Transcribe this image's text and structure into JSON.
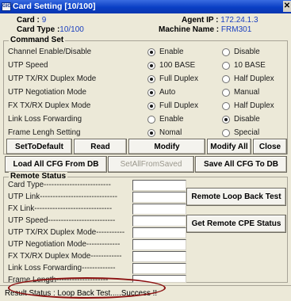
{
  "window": {
    "title": "Card Setting [10/100]",
    "icon_text": "GIGA"
  },
  "info": {
    "card_label": "Card :",
    "card_value": "9",
    "card_type_label": "Card Type :",
    "card_type_value": "10/100",
    "agent_ip_label": "Agent IP :",
    "agent_ip_value": "172.24.1.3",
    "machine_name_label": "Machine Name :",
    "machine_name_value": "FRM301"
  },
  "command_set": {
    "title": "Command  Set",
    "rows": [
      {
        "label": "Channel Enable/Disable",
        "opt1": "Enable",
        "opt2": "Disable",
        "selected": 1
      },
      {
        "label": "UTP Speed",
        "opt1": "100 BASE",
        "opt2": "10 BASE",
        "selected": 1
      },
      {
        "label": "UTP TX/RX Duplex Mode",
        "opt1": "Full Duplex",
        "opt2": "Half Duplex",
        "selected": 1
      },
      {
        "label": "UTP Negotiation Mode",
        "opt1": "Auto",
        "opt2": "Manual",
        "selected": 1
      },
      {
        "label": "FX TX/RX Duplex Mode",
        "opt1": "Full Duplex",
        "opt2": "Half Duplex",
        "selected": 1
      },
      {
        "label": "Link Loss Forwarding",
        "opt1": "Enable",
        "opt2": "Disable",
        "selected": 2
      },
      {
        "label": "Frame Lengh Setting",
        "opt1": "Nomal",
        "opt2": "Special",
        "selected": 1
      }
    ],
    "buttons": {
      "set_default": "SetToDefault",
      "read": "Read",
      "modify": "Modify",
      "modify_all": "Modify All",
      "close": "Close"
    }
  },
  "db_buttons": {
    "load_all": "Load All CFG From DB",
    "set_all_from_saved": "SetAllFromSaved",
    "save_all": "Save All CFG To DB"
  },
  "remote_status": {
    "title": "Remote Status",
    "rows": [
      {
        "label": "Card Type--------------------------",
        "value": ""
      },
      {
        "label": "UTP Link------------------------------",
        "value": ""
      },
      {
        "label": "FX    Link------------------------------",
        "value": ""
      },
      {
        "label": "UTP Speed--------------------------",
        "value": ""
      },
      {
        "label": "UTP TX/RX Duplex Mode-----------",
        "value": ""
      },
      {
        "label": "UTP Negotiation Mode-------------",
        "value": ""
      },
      {
        "label": "FX TX/RX Duplex Mode------------",
        "value": ""
      },
      {
        "label": "Link Loss Forwarding-------------",
        "value": ""
      },
      {
        "label": "Frame Length--------------------",
        "value": ""
      }
    ],
    "loop_back_button": "Remote Loop Back Test",
    "cpe_status_button": "Get Remote CPE Status"
  },
  "status_bar": {
    "text": "Result Status : Loop Back Test.....Success !!"
  },
  "colors": {
    "title_blue": "#0a3fc4",
    "info_value_blue": "#1a3fbf",
    "highlight_oval": "#8b1010"
  }
}
